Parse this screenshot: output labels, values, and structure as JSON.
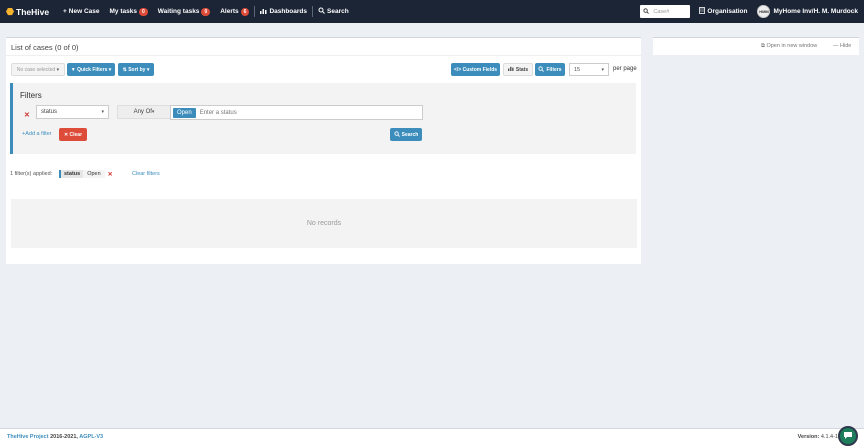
{
  "navbar": {
    "brand": "TheHive",
    "new_case": "New Case",
    "my_tasks": "My tasks",
    "my_tasks_count": "0",
    "waiting_tasks": "Waiting tasks",
    "waiting_tasks_count": "0",
    "alerts": "Alerts",
    "alerts_count": "6",
    "dashboards": "Dashboards",
    "search": "Search",
    "caseid_placeholder": "Case#",
    "organisation": "Organisation",
    "avatar_initials": "HMM",
    "user": "MyHome Inv/H. M. Murdock"
  },
  "main": {
    "title": "List of cases (0 of 0)",
    "toolbar": {
      "no_case_selected": "No case selected",
      "quick_filters": "Quick Filters",
      "sort_by": "Sort by",
      "custom_fields": "Custom Fields",
      "stats": "Stats",
      "filters": "Filters",
      "page_size": "15",
      "per_page": "per page"
    },
    "filters_panel": {
      "title": "Filters",
      "field": "status",
      "operator": "Any Of",
      "selected_value": "Open",
      "value_placeholder": "Enter a status",
      "add_filter": "Add a filter",
      "clear": "Clear",
      "search": "Search"
    },
    "applied": {
      "text": "1 filter(s) applied:",
      "key": "status",
      "value": "Open",
      "clear_filters": "Clear filters"
    },
    "empty": "No records"
  },
  "side": {
    "open_new_window": "Open in new window",
    "hide": "Hide"
  },
  "footer": {
    "project": "TheHive Project",
    "years": "2016-2021,",
    "license": "AGPL-V3",
    "version_label": "Version:",
    "version": "4.1.4-1"
  },
  "colors": {
    "navbar": "#1b2536",
    "primary": "#3c8dbc",
    "danger": "#dd4b39",
    "brand": "#f6b32b"
  }
}
